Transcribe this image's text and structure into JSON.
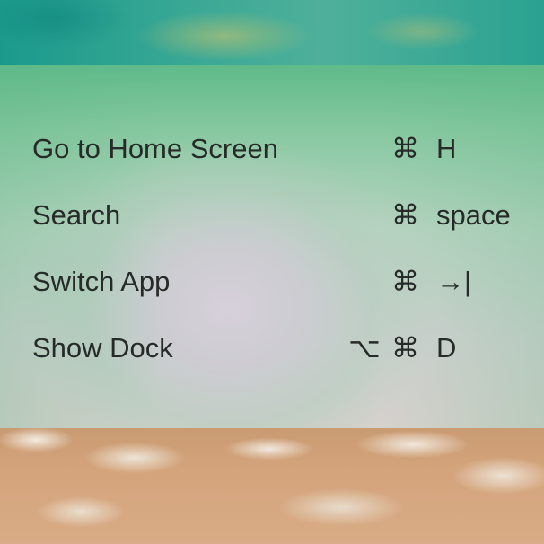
{
  "shortcuts": [
    {
      "label": "Go to Home Screen",
      "modifiers": [
        "",
        "⌘"
      ],
      "key": "H"
    },
    {
      "label": "Search",
      "modifiers": [
        "",
        "⌘"
      ],
      "key": "space"
    },
    {
      "label": "Switch App",
      "modifiers": [
        "",
        "⌘"
      ],
      "key": "→|"
    },
    {
      "label": "Show Dock",
      "modifiers": [
        "⌥",
        "⌘"
      ],
      "key": "D"
    }
  ]
}
